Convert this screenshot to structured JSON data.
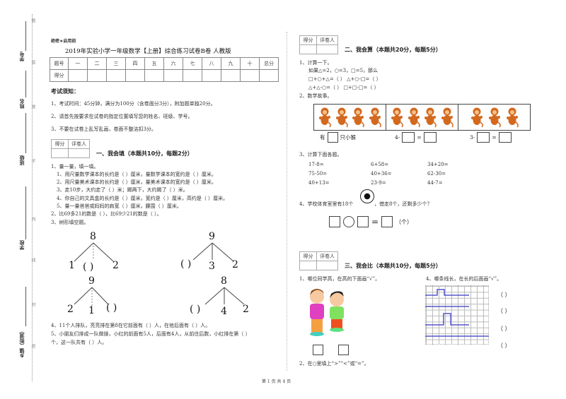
{
  "binding": {
    "labels": [
      "学号",
      "姓名",
      "班级",
      "学校",
      "乡镇（街道）"
    ],
    "cut_marks": [
      "题",
      "答",
      "准",
      "不",
      "内",
      "线",
      "封",
      "密"
    ]
  },
  "header": {
    "secret_label": "绝密★启用前",
    "title": "2019年实验小学一年级数学【上册】综合练习试卷B卷 人教版",
    "score_table": {
      "row1": [
        "题号",
        "一",
        "二",
        "三",
        "四",
        "五",
        "六",
        "七",
        "八",
        "九",
        "十",
        "总分"
      ],
      "row2_label": "得分"
    }
  },
  "notes": {
    "heading": "考试须知：",
    "items": [
      "1、考试时间：45分钟，满分为100分（含卷面分3分），附加题单独20分。",
      "2、请首先按要求在试卷的指定位置填写您的姓名、班级、学号。",
      "3、不要在试卷上乱写乱画，卷面不整洁扣3分。"
    ]
  },
  "grader_box": {
    "score": "得分",
    "grader": "评卷人"
  },
  "section1": {
    "title": "一、我会填（本题共10分，每题2分）",
    "lines": [
      "1、量一量，填一填。",
      "1、用尺量数学课本的长约是（    ）厘米，量数学课本的宽约是（    ）厘米。",
      "2、用尺量美术课本的长约是（    ）厘米，量美术课本的宽约是（    ）厘米。",
      "3、走10步，大约走了（  ）米；踢两下，大约踢了（    ）米。",
      "4、你自己的文具盒的长约是（    ）厘米，宽约是（    ）厘米，高约是（    ）厘米。",
      "5、量一量爸爸或妈妈的肩宽（    ）厘米，腰围（    ）厘米。",
      "2、比69多21的数是（        ），比69少21的数是（     ）。",
      "3、树形填空题。"
    ],
    "trees": [
      {
        "top": "8",
        "children": [
          "1",
          "(  )",
          "2"
        ]
      },
      {
        "top": "9",
        "children": [
          "(  )",
          "3",
          "2"
        ]
      },
      {
        "top": "9",
        "children": [
          "2",
          "1",
          "(  )"
        ]
      },
      {
        "top": "8",
        "children": [
          "(  )",
          "4",
          "2"
        ]
      }
    ],
    "q4": "4、11个人排队，亮亮排在第8在它前面有（    ）人，在他后面有（    ）人。",
    "q5a": "5、小朋友们排成一队做操，小红的前面有5人，后面有4人，从前往后数，小红排在第（      ）",
    "q5b": "个，这一队共有（     ）人。"
  },
  "section2": {
    "title": "二、我会算（本题共20分，每题5分）",
    "q1": [
      "1、计算一下。",
      "如果△=2，○=3，□=5，那么",
      "□+○+△=（        ）    △+○-□=（        ）",
      "△+△-○=（        ）    □+□-□=（        ）"
    ],
    "q2": "2、数学故事。",
    "story": {
      "groups": [
        4,
        4,
        3
      ],
      "labels": [
        "有",
        "只小猴",
        "4-",
        "=",
        "3-",
        "="
      ]
    },
    "q3": "3、计算下面各题。",
    "calcs": [
      "17-8=",
      "6+58=",
      "34+20=",
      "75-50=",
      "40+36=",
      "62-30=",
      "40+13=",
      "23-9=",
      "44-7="
    ],
    "q4": "4、学校体育室里有18个",
    "q4b": "，借走8个，还剩多少个？",
    "unit": "（个）"
  },
  "section3": {
    "title": "三、我会比（本题共10分，每题5分）",
    "q1": "1、哪位同学高，在高的下面画“√”。",
    "q4": "4、哪条线长，在长的后面画“√”。",
    "q2": "2、在○里填上“>”“<”或“=”。",
    "parens": [
      "（      ）",
      "（      ）",
      "（      ）",
      "（      ）"
    ]
  },
  "footer": {
    "page": "第 1 页 共 4 页"
  }
}
